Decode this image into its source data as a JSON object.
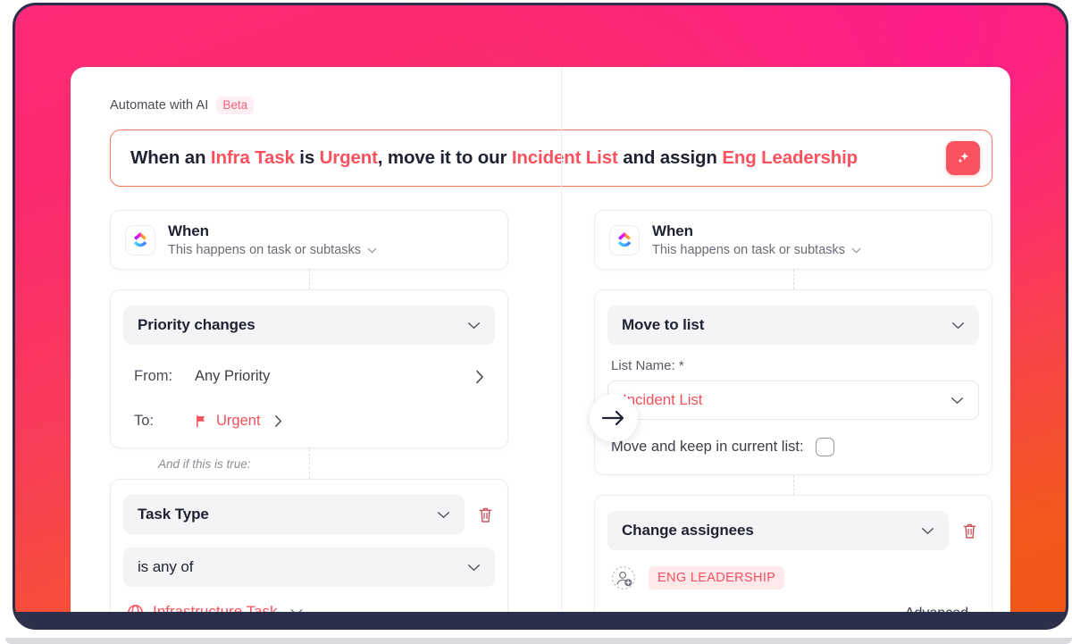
{
  "header": {
    "title": "Automate with AI",
    "badge": "Beta"
  },
  "prompt": {
    "segments": [
      {
        "text": "When an ",
        "highlight": false
      },
      {
        "text": "Infra Task",
        "highlight": true
      },
      {
        "text": " is ",
        "highlight": false
      },
      {
        "text": "Urgent",
        "highlight": true
      },
      {
        "text": ", move it to our ",
        "highlight": false
      },
      {
        "text": "Incident List",
        "highlight": true
      },
      {
        "text": " and assign ",
        "highlight": false
      },
      {
        "text": "Eng Leadership",
        "highlight": true
      }
    ],
    "ai_button_icon": "sparkle-icon"
  },
  "left_column": {
    "trigger": {
      "title": "When",
      "subtitle": "This happens on task or subtasks",
      "logo_icon": "clickup-logo-icon",
      "chevron_icon": "chevron-down-icon"
    },
    "condition": {
      "event": "Priority changes",
      "from_label": "From:",
      "from_value": "Any Priority",
      "to_label": "To:",
      "to_value": "Urgent",
      "to_icon": "flag-icon",
      "chevron_right_icon": "chevron-right-icon"
    },
    "and_if_label": "And if this is true:",
    "filter": {
      "field": "Task Type",
      "operator": "is any of",
      "value": "Infrastructure Task",
      "value_icon": "globe-icon",
      "delete_icon": "trash-icon"
    }
  },
  "right_column": {
    "trigger": {
      "title": "When",
      "subtitle": "This happens on task or subtasks",
      "logo_icon": "clickup-logo-icon",
      "chevron_icon": "chevron-down-icon"
    },
    "action_move": {
      "action": "Move to list",
      "list_name_label": "List Name: *",
      "list_name_value": "Incident List",
      "keep_label": "Move and keep in current list:",
      "keep_checked": false
    },
    "action_assign": {
      "action": "Change assignees",
      "assignee": "ENG LEADERSHIP",
      "add_icon": "add-person-icon",
      "delete_icon": "trash-icon",
      "advanced_link": "Advanced"
    }
  },
  "connector": {
    "arrow_icon": "arrow-right-icon"
  },
  "colors": {
    "accent_red": "#f4515d",
    "ai_button": "#f8535f",
    "prompt_border": "#f0785e",
    "badge_bg": "#fdeff1",
    "frame_dark": "#2b2f4a"
  }
}
